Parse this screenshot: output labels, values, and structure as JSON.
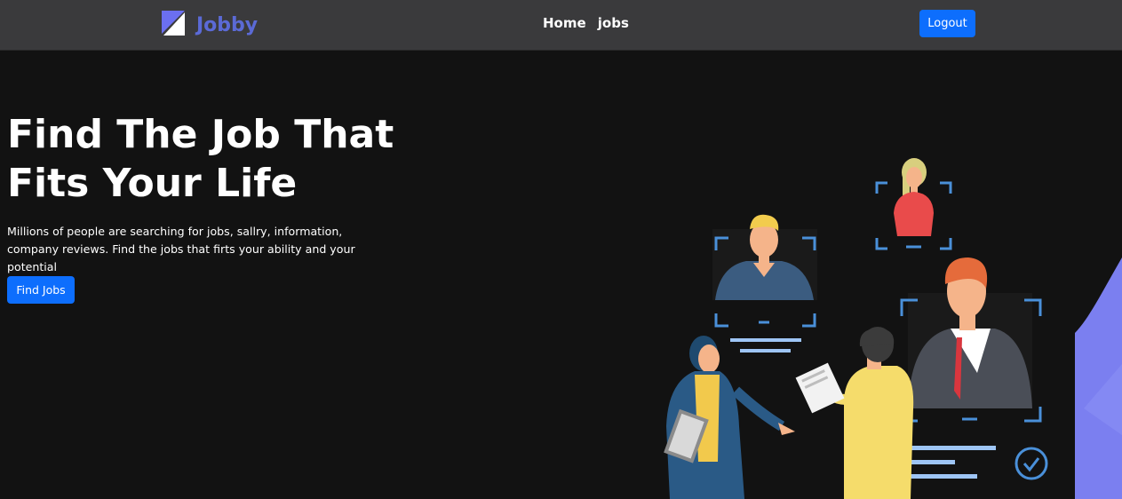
{
  "brand": {
    "name": "Jobby",
    "color": "#5b6ad6"
  },
  "nav": {
    "links": [
      "Home",
      "jobs"
    ],
    "logout_label": "Logout"
  },
  "hero": {
    "heading_line1": "Find The Job That",
    "heading_line2": "Fits Your Life",
    "description": "Millions of people are searching for jobs, sallry, information, company reviews. Find the jobs that firts your ability and your potential",
    "cta_label": "Find Jobs"
  },
  "colors": {
    "navbar_bg": "#3a3a3c",
    "page_bg": "#121212",
    "primary_button": "#0d6efd",
    "accent_purple": "#7b7ff0"
  },
  "illustration": {
    "icon": "job-recruitment-illustration"
  }
}
